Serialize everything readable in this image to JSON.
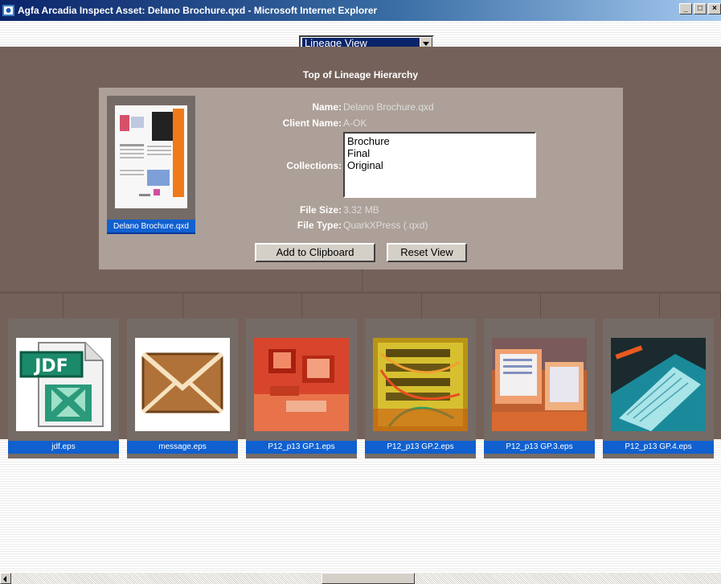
{
  "window": {
    "title": "Agfa Arcadia Inspect Asset: Delano Brochure.qxd - Microsoft Internet Explorer",
    "minimize": "_",
    "maximize": "□",
    "close": "×"
  },
  "view_select": {
    "value": "Lineage View"
  },
  "lineage": {
    "title": "Top of Lineage Hierarchy",
    "asset": {
      "thumbnail_caption": "Delano Brochure.qxd",
      "name_label": "Name:",
      "name_value": "Delano Brochure.qxd",
      "client_label": "Client Name:",
      "client_value": "A-OK",
      "collections_label": "Collections:",
      "collections": [
        "Brochure",
        "Final",
        "Original"
      ],
      "filesize_label": "File Size:",
      "filesize_value": "3.32 MB",
      "filetype_label": "File Type:",
      "filetype_value": "QuarkXPress (.qxd)"
    },
    "buttons": {
      "clipboard": "Add to Clipboard",
      "reset": "Reset View"
    }
  },
  "children": [
    {
      "caption": "jdf.eps",
      "icon": "jdf-file-icon"
    },
    {
      "caption": "message.eps",
      "icon": "envelope-icon"
    },
    {
      "caption": "P12_p13 GP.1.eps",
      "icon": "photo-computers-red"
    },
    {
      "caption": "P12_p13 GP.2.eps",
      "icon": "photo-cables-yellow"
    },
    {
      "caption": "P12_p13 GP.3.eps",
      "icon": "photo-monitors-orange"
    },
    {
      "caption": "P12_p13 GP.4.eps",
      "icon": "photo-notebook-teal"
    }
  ],
  "colors": {
    "brown": "#74625a",
    "panel": "#ada098",
    "caption_blue": "#1060d0"
  }
}
